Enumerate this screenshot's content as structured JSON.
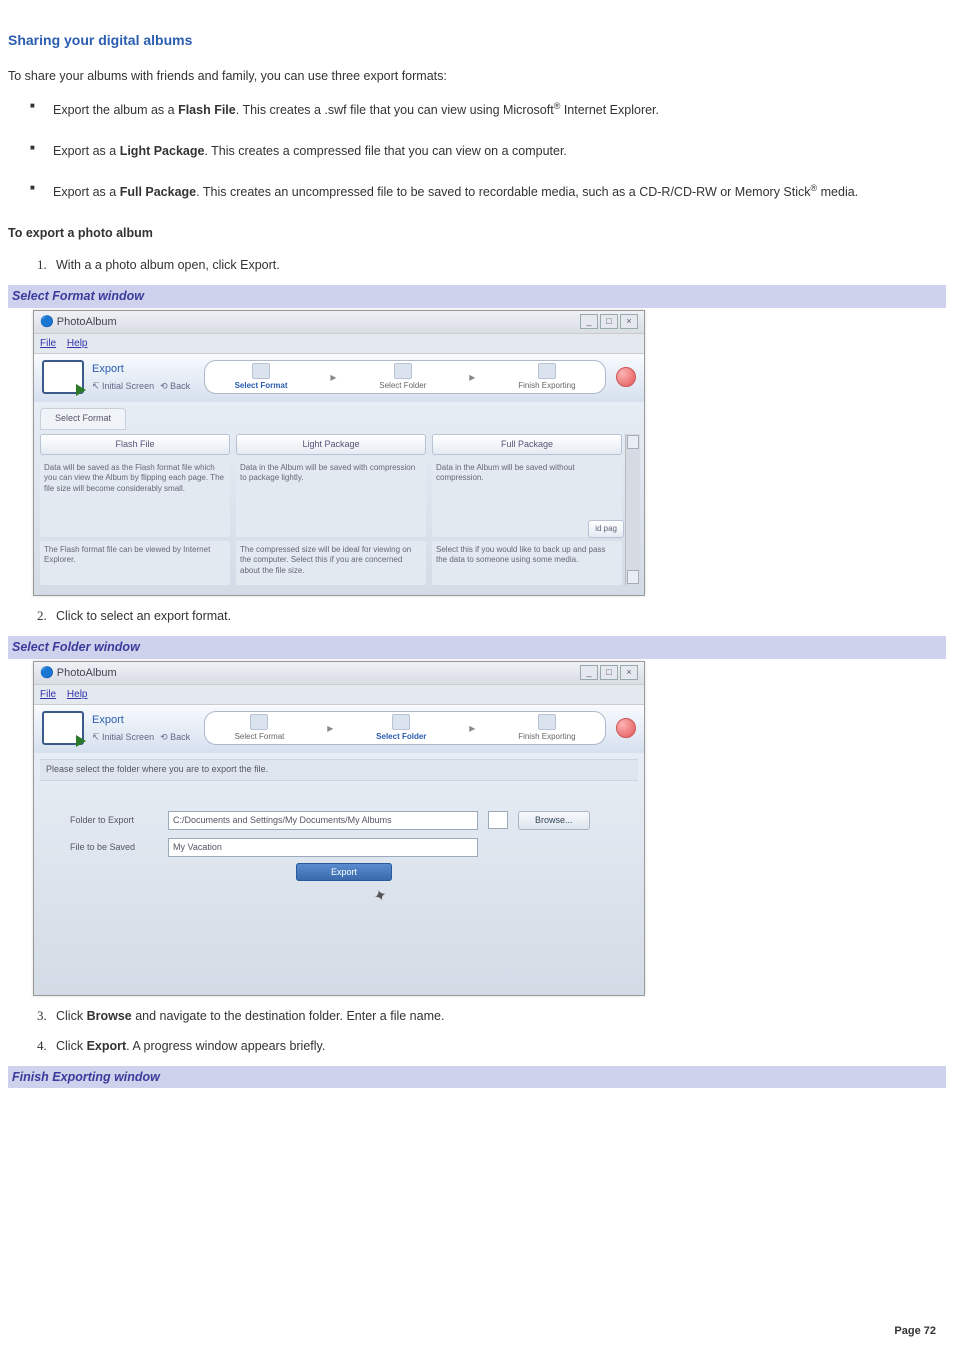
{
  "title": "Sharing your digital albums",
  "intro": "To share your albums with friends and family, you can use three export formats:",
  "bullets": [
    {
      "pre": "Export the album as a ",
      "bold": "Flash File",
      "post1": ". This creates a .swf file that you can view using Microsoft",
      "reg": "®",
      "post2": " Internet Explorer."
    },
    {
      "pre": "Export as a ",
      "bold": "Light Package",
      "post1": ". This creates a compressed file that you can view on a computer.",
      "reg": "",
      "post2": ""
    },
    {
      "pre": "Export as a ",
      "bold": "Full Package",
      "post1": ". This creates an uncompressed file to be saved to recordable media, such as a CD-R/CD-RW or Memory Stick",
      "reg": "®",
      "post2": " media."
    }
  ],
  "export_heading": "To export a photo album",
  "steps_top": [
    "With a a photo album open, click Export."
  ],
  "caption1": "Select Format window",
  "app1": {
    "title": "PhotoAlbum",
    "menu_file": "File",
    "menu_help": "Help",
    "export_label": "Export",
    "initial": "Initial Screen",
    "back": "Back",
    "wiz_format": "Select Format",
    "wiz_folder": "Select Folder",
    "wiz_finish": "Finish Exporting",
    "tab_label": "Select Format",
    "col1_btn": "Flash File",
    "col1_desc1": "Data will be saved as the Flash format file which you can view the Album by flipping each page. The file size will become considerably small.",
    "col1_desc2": "The Flash format file can be viewed by Internet Explorer.",
    "col2_btn": "Light Package",
    "col2_desc1": "Data in the Album will be saved with compression to package lightly.",
    "col2_desc2": "The compressed size will be ideal for viewing on the computer. Select this if you are concerned about the file size.",
    "col3_btn": "Full Package",
    "col3_desc1": "Data in the Album will be saved without compression.",
    "col3_desc2": "Select this if you would like to back up and pass the data to someone using some media.",
    "side_tag": "id pag"
  },
  "steps_mid": [
    "Click to select an export format."
  ],
  "caption2": "Select Folder window",
  "app2": {
    "title": "PhotoAlbum",
    "instr": "Please select the folder where you are to export the file.",
    "label_folder": "Folder to Export",
    "value_folder": "C:/Documents and Settings/My Documents/My Albums",
    "label_file": "File to be Saved",
    "value_file": "My Vacation",
    "browse": "Browse...",
    "export_btn": "Export"
  },
  "steps_bottom": [
    {
      "pre": "Click ",
      "bold": "Browse",
      "post": " and navigate to the destination folder. Enter a file name."
    },
    {
      "pre": "Click ",
      "bold": "Export",
      "post": ". A progress window appears briefly."
    }
  ],
  "caption3": "Finish Exporting window",
  "page_footer": "Page 72"
}
